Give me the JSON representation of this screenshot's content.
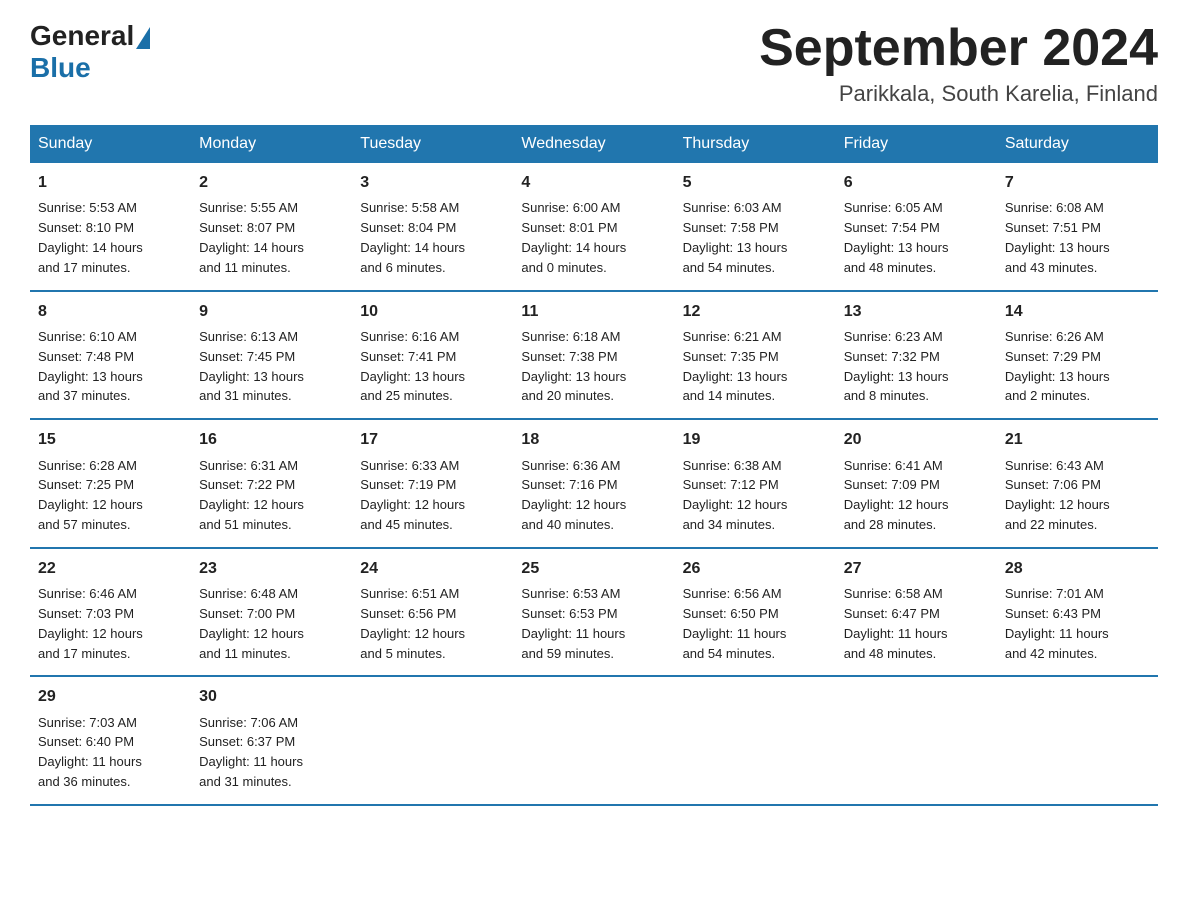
{
  "header": {
    "logo_general": "General",
    "logo_blue": "Blue",
    "title": "September 2024",
    "subtitle": "Parikkala, South Karelia, Finland"
  },
  "days_of_week": [
    "Sunday",
    "Monday",
    "Tuesday",
    "Wednesday",
    "Thursday",
    "Friday",
    "Saturday"
  ],
  "weeks": [
    [
      {
        "day": "1",
        "sunrise": "5:53 AM",
        "sunset": "8:10 PM",
        "daylight": "14 hours and 17 minutes."
      },
      {
        "day": "2",
        "sunrise": "5:55 AM",
        "sunset": "8:07 PM",
        "daylight": "14 hours and 11 minutes."
      },
      {
        "day": "3",
        "sunrise": "5:58 AM",
        "sunset": "8:04 PM",
        "daylight": "14 hours and 6 minutes."
      },
      {
        "day": "4",
        "sunrise": "6:00 AM",
        "sunset": "8:01 PM",
        "daylight": "14 hours and 0 minutes."
      },
      {
        "day": "5",
        "sunrise": "6:03 AM",
        "sunset": "7:58 PM",
        "daylight": "13 hours and 54 minutes."
      },
      {
        "day": "6",
        "sunrise": "6:05 AM",
        "sunset": "7:54 PM",
        "daylight": "13 hours and 48 minutes."
      },
      {
        "day": "7",
        "sunrise": "6:08 AM",
        "sunset": "7:51 PM",
        "daylight": "13 hours and 43 minutes."
      }
    ],
    [
      {
        "day": "8",
        "sunrise": "6:10 AM",
        "sunset": "7:48 PM",
        "daylight": "13 hours and 37 minutes."
      },
      {
        "day": "9",
        "sunrise": "6:13 AM",
        "sunset": "7:45 PM",
        "daylight": "13 hours and 31 minutes."
      },
      {
        "day": "10",
        "sunrise": "6:16 AM",
        "sunset": "7:41 PM",
        "daylight": "13 hours and 25 minutes."
      },
      {
        "day": "11",
        "sunrise": "6:18 AM",
        "sunset": "7:38 PM",
        "daylight": "13 hours and 20 minutes."
      },
      {
        "day": "12",
        "sunrise": "6:21 AM",
        "sunset": "7:35 PM",
        "daylight": "13 hours and 14 minutes."
      },
      {
        "day": "13",
        "sunrise": "6:23 AM",
        "sunset": "7:32 PM",
        "daylight": "13 hours and 8 minutes."
      },
      {
        "day": "14",
        "sunrise": "6:26 AM",
        "sunset": "7:29 PM",
        "daylight": "13 hours and 2 minutes."
      }
    ],
    [
      {
        "day": "15",
        "sunrise": "6:28 AM",
        "sunset": "7:25 PM",
        "daylight": "12 hours and 57 minutes."
      },
      {
        "day": "16",
        "sunrise": "6:31 AM",
        "sunset": "7:22 PM",
        "daylight": "12 hours and 51 minutes."
      },
      {
        "day": "17",
        "sunrise": "6:33 AM",
        "sunset": "7:19 PM",
        "daylight": "12 hours and 45 minutes."
      },
      {
        "day": "18",
        "sunrise": "6:36 AM",
        "sunset": "7:16 PM",
        "daylight": "12 hours and 40 minutes."
      },
      {
        "day": "19",
        "sunrise": "6:38 AM",
        "sunset": "7:12 PM",
        "daylight": "12 hours and 34 minutes."
      },
      {
        "day": "20",
        "sunrise": "6:41 AM",
        "sunset": "7:09 PM",
        "daylight": "12 hours and 28 minutes."
      },
      {
        "day": "21",
        "sunrise": "6:43 AM",
        "sunset": "7:06 PM",
        "daylight": "12 hours and 22 minutes."
      }
    ],
    [
      {
        "day": "22",
        "sunrise": "6:46 AM",
        "sunset": "7:03 PM",
        "daylight": "12 hours and 17 minutes."
      },
      {
        "day": "23",
        "sunrise": "6:48 AM",
        "sunset": "7:00 PM",
        "daylight": "12 hours and 11 minutes."
      },
      {
        "day": "24",
        "sunrise": "6:51 AM",
        "sunset": "6:56 PM",
        "daylight": "12 hours and 5 minutes."
      },
      {
        "day": "25",
        "sunrise": "6:53 AM",
        "sunset": "6:53 PM",
        "daylight": "11 hours and 59 minutes."
      },
      {
        "day": "26",
        "sunrise": "6:56 AM",
        "sunset": "6:50 PM",
        "daylight": "11 hours and 54 minutes."
      },
      {
        "day": "27",
        "sunrise": "6:58 AM",
        "sunset": "6:47 PM",
        "daylight": "11 hours and 48 minutes."
      },
      {
        "day": "28",
        "sunrise": "7:01 AM",
        "sunset": "6:43 PM",
        "daylight": "11 hours and 42 minutes."
      }
    ],
    [
      {
        "day": "29",
        "sunrise": "7:03 AM",
        "sunset": "6:40 PM",
        "daylight": "11 hours and 36 minutes."
      },
      {
        "day": "30",
        "sunrise": "7:06 AM",
        "sunset": "6:37 PM",
        "daylight": "11 hours and 31 minutes."
      },
      null,
      null,
      null,
      null,
      null
    ]
  ],
  "labels": {
    "sunrise": "Sunrise:",
    "sunset": "Sunset:",
    "daylight": "Daylight:"
  }
}
